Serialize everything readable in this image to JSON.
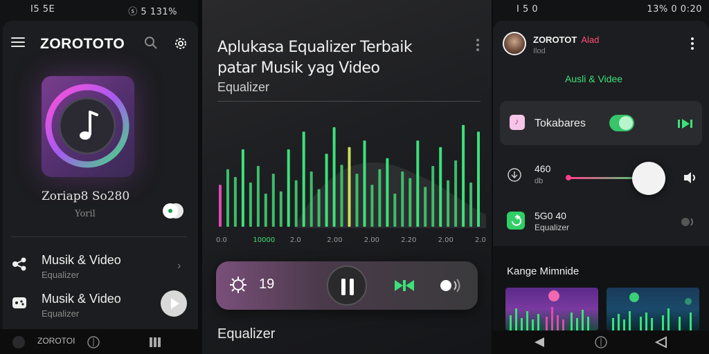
{
  "screen1": {
    "status_left": "I5 5E",
    "status_right": "ⓢ 5 131%",
    "app_title": "ZOROTOTO",
    "now_playing": {
      "title": "Zoriap8 So280",
      "subtitle": "Yoril"
    },
    "menu": [
      {
        "title": "Musik & Video",
        "subtitle": "Equalizer"
      },
      {
        "title": "Musik & Video",
        "subtitle": "Equalizer"
      }
    ],
    "bottom_label": "ZOROTOI"
  },
  "screen2": {
    "title_line1": "Aplukasa Equalizer Terbaik",
    "title_line2": "patar Musik yag Video",
    "subtitle": "Equalizer",
    "axis_ticks": [
      "0.0",
      "10000",
      "2.0",
      "2.00",
      "2.00",
      "2.20",
      "2.00",
      "2.00"
    ],
    "player_value": "19",
    "footer_label": "Equalizer",
    "accent_color": "#3de07a",
    "eq_bars": [
      {
        "h": 0.38,
        "c": "#e04ab0"
      },
      {
        "h": 0.52,
        "c": "#3dbd6a"
      },
      {
        "h": 0.45,
        "c": "#3dbd6a"
      },
      {
        "h": 0.7,
        "c": "#3de07a"
      },
      {
        "h": 0.4,
        "c": "#3dbd6a"
      },
      {
        "h": 0.55,
        "c": "#3dbd6a"
      },
      {
        "h": 0.3,
        "c": "#3dbd6a"
      },
      {
        "h": 0.48,
        "c": "#3dbd6a"
      },
      {
        "h": 0.32,
        "c": "#3dbd6a"
      },
      {
        "h": 0.7,
        "c": "#3de07a"
      },
      {
        "h": 0.42,
        "c": "#3dbd6a"
      },
      {
        "h": 0.86,
        "c": "#3de07a"
      },
      {
        "h": 0.5,
        "c": "#3dbd6a"
      },
      {
        "h": 0.34,
        "c": "#3dbd6a"
      },
      {
        "h": 0.66,
        "c": "#3de07a"
      },
      {
        "h": 0.9,
        "c": "#3de07a"
      },
      {
        "h": 0.56,
        "c": "#3dbd6a"
      },
      {
        "h": 0.72,
        "c": "#c9e05a"
      },
      {
        "h": 0.48,
        "c": "#3dbd6a"
      },
      {
        "h": 0.78,
        "c": "#3de07a"
      },
      {
        "h": 0.38,
        "c": "#3dbd6a"
      },
      {
        "h": 0.52,
        "c": "#3dbd6a"
      },
      {
        "h": 0.62,
        "c": "#3de07a"
      },
      {
        "h": 0.3,
        "c": "#3dbd6a"
      },
      {
        "h": 0.5,
        "c": "#3dbd6a"
      },
      {
        "h": 0.44,
        "c": "#3dbd6a"
      },
      {
        "h": 0.78,
        "c": "#3de07a"
      },
      {
        "h": 0.36,
        "c": "#3dbd6a"
      },
      {
        "h": 0.55,
        "c": "#3dbd6a"
      },
      {
        "h": 0.72,
        "c": "#3de07a"
      },
      {
        "h": 0.42,
        "c": "#3dbd6a"
      },
      {
        "h": 0.6,
        "c": "#3dbd6a"
      },
      {
        "h": 0.92,
        "c": "#3de07a"
      },
      {
        "h": 0.4,
        "c": "#3dbd6a"
      },
      {
        "h": 0.86,
        "c": "#3de07a"
      }
    ]
  },
  "screen3": {
    "status_left": "I 5 0",
    "status_right": "13% 0 0:20",
    "user_name": "ZOROTOT",
    "user_tag": "Alad",
    "user_sub": "Ilod",
    "link": "Ausli & Videe",
    "toggle_row_label": "Tokabares",
    "slider_value": "460",
    "slider_unit": "db",
    "slider_level": 0.82,
    "eq_value": "5G0 40",
    "eq_label": "Equalizer",
    "section_title": "Kange Mimnide"
  }
}
